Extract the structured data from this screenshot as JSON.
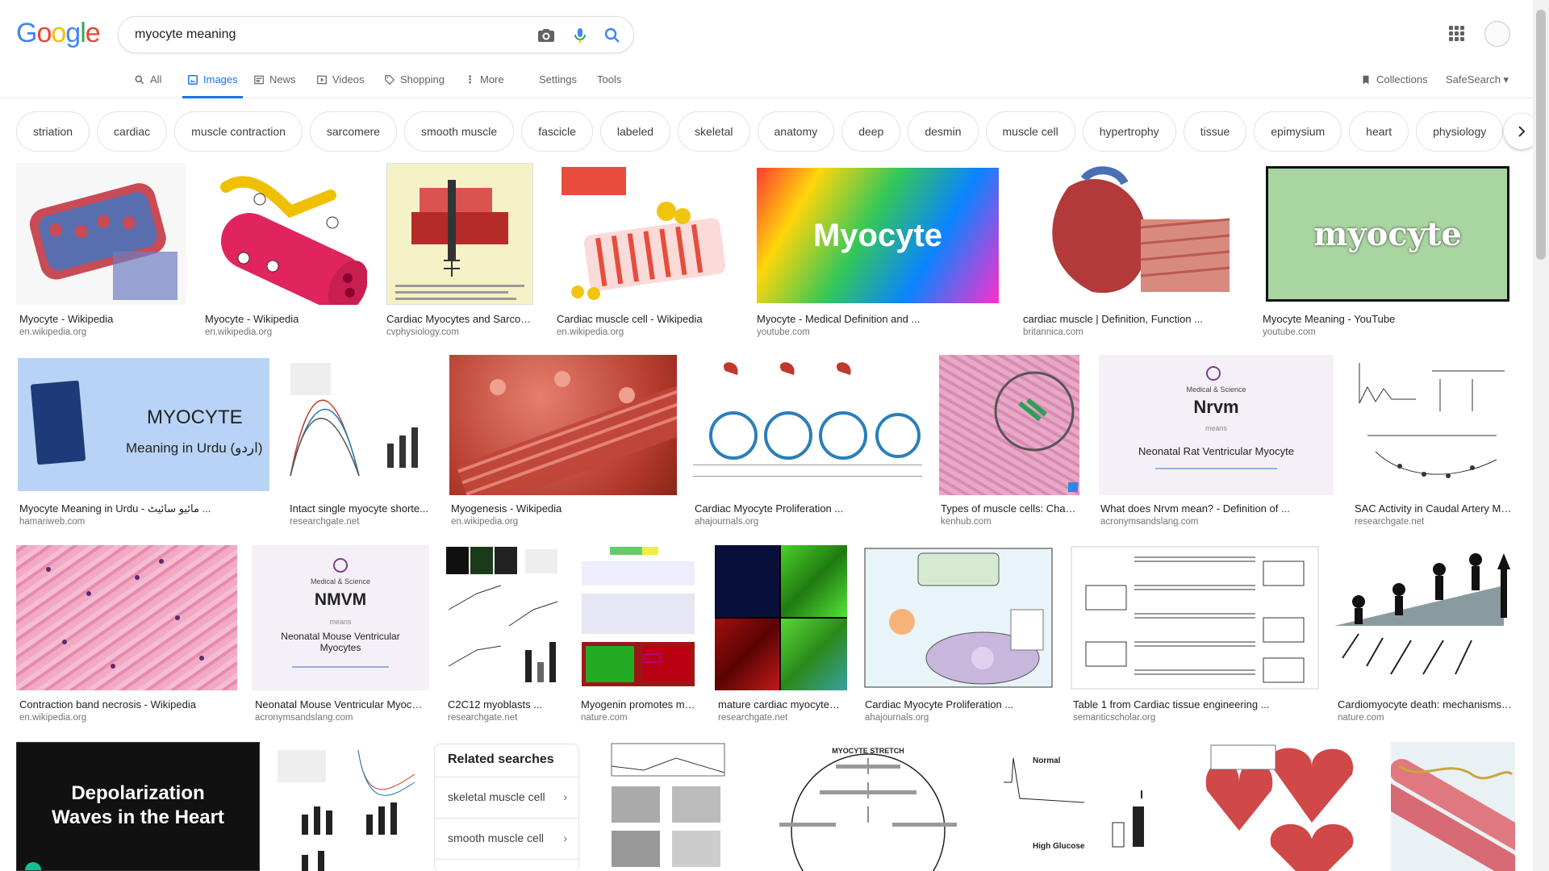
{
  "logo": "Google",
  "search": {
    "query": "myocyte meaning"
  },
  "tabs": {
    "all": "All",
    "images": "Images",
    "news": "News",
    "videos": "Videos",
    "shopping": "Shopping",
    "more": "More",
    "settings": "Settings",
    "tools": "Tools",
    "collections": "Collections",
    "safesearch": "SafeSearch ▾"
  },
  "chips": [
    "striation",
    "cardiac",
    "muscle contraction",
    "sarcomere",
    "smooth muscle",
    "fascicle",
    "labeled",
    "skeletal",
    "anatomy",
    "deep",
    "desmin",
    "muscle cell",
    "hypertrophy",
    "tissue",
    "epimysium",
    "heart",
    "physiology"
  ],
  "row1": [
    {
      "cap": "Myocyte - Wikipedia",
      "src": "en.wikipedia.org"
    },
    {
      "cap": "Myocyte - Wikipedia",
      "src": "en.wikipedia.org"
    },
    {
      "cap": "Cardiac Myocytes and Sarcom...",
      "src": "cvphysiology.com"
    },
    {
      "cap": "Cardiac muscle cell - Wikipedia",
      "src": "en.wikipedia.org"
    },
    {
      "cap": "Myocyte - Medical Definition and ...",
      "src": "youtube.com",
      "overlay": "Myocyte"
    },
    {
      "cap": "cardiac muscle | Definition, Function ...",
      "src": "britannica.com"
    },
    {
      "cap": "Myocyte Meaning - YouTube",
      "src": "youtube.com",
      "overlay": "myocyte"
    }
  ],
  "row2": [
    {
      "cap": "Myocyte Meaning in Urdu - مائیو سائیٹ ...",
      "src": "hamariweb.com",
      "title": "MYOCYTE",
      "sub": "Meaning in Urdu (اردو)"
    },
    {
      "cap": "Intact single myocyte shorte...",
      "src": "researchgate.net"
    },
    {
      "cap": "Myogenesis - Wikipedia",
      "src": "en.wikipedia.org"
    },
    {
      "cap": "Cardiac Myocyte Proliferation ...",
      "src": "ahajournals.org"
    },
    {
      "cap": "Types of muscle cells: Chara...",
      "src": "kenhub.com"
    },
    {
      "cap": "What does Nrvm mean? - Definition of ...",
      "src": "acronymsandslang.com",
      "small": "Medical & Science",
      "title": "Nrvm",
      "means": "means",
      "sub": "Neonatal Rat Ventricular Myocyte"
    },
    {
      "cap": "SAC Activity in Caudal Artery My...",
      "src": "researchgate.net"
    }
  ],
  "row3": [
    {
      "cap": "Contraction band necrosis - Wikipedia",
      "src": "en.wikipedia.org"
    },
    {
      "cap": "Neonatal Mouse Ventricular Myocyt...",
      "src": "acronymsandslang.com",
      "small": "Medical & Science",
      "title": "NMVM",
      "means": "means",
      "sub": "Neonatal Mouse Ventricular Myocytes"
    },
    {
      "cap": "C2C12 myoblasts ...",
      "src": "researchgate.net"
    },
    {
      "cap": "Myogenin promotes my...",
      "src": "nature.com"
    },
    {
      "cap": "mature cardiac myocytes....",
      "src": "researchgate.net"
    },
    {
      "cap": "Cardiac Myocyte Proliferation ...",
      "src": "ahajournals.org"
    },
    {
      "cap": "Table 1 from Cardiac tissue engineering ...",
      "src": "semanticscholar.org"
    },
    {
      "cap": "Cardiomyocyte death: mechanisms ...",
      "src": "nature.com"
    }
  ],
  "row4": {
    "depol": "Depolarization Waves in the Heart",
    "related_title": "Related searches",
    "related": [
      "skeletal muscle cell",
      "smooth muscle cell"
    ],
    "stretch_title": "MYOCYTE STRETCH",
    "normal": "Normal",
    "high_glucose": "High Glucose"
  },
  "colors": {
    "accent": "#1a73e8"
  }
}
